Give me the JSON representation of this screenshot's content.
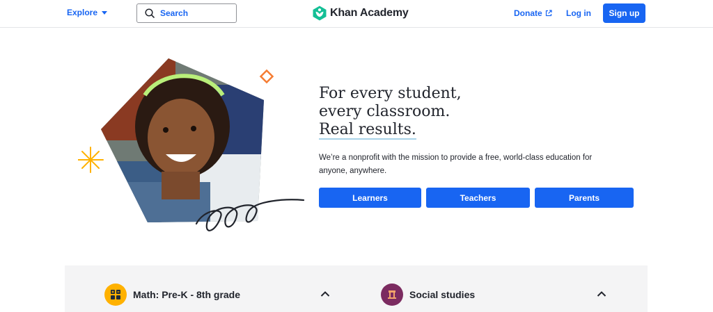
{
  "header": {
    "explore_label": "Explore",
    "search_label": "Search",
    "logo_text": "Khan Academy",
    "donate_label": "Donate",
    "login_label": "Log in",
    "signup_label": "Sign up"
  },
  "hero": {
    "headline_line1": "For every student,",
    "headline_line2": "every classroom.",
    "headline_line3": "Real results.",
    "description": "We’re a nonprofit with the mission to provide a free, world-class education for anyone, anywhere.",
    "buttons": [
      {
        "label": "Learners"
      },
      {
        "label": "Teachers"
      },
      {
        "label": "Parents"
      }
    ]
  },
  "categories": [
    {
      "label": "Math: Pre-K - 8th grade",
      "icon": "math-icon",
      "color": "#ffb100"
    },
    {
      "label": "Social studies",
      "icon": "social-studies-icon",
      "color": "#7b2b60"
    }
  ],
  "colors": {
    "primary": "#1865f2",
    "logo_green": "#14bf96",
    "text": "#21242c"
  }
}
